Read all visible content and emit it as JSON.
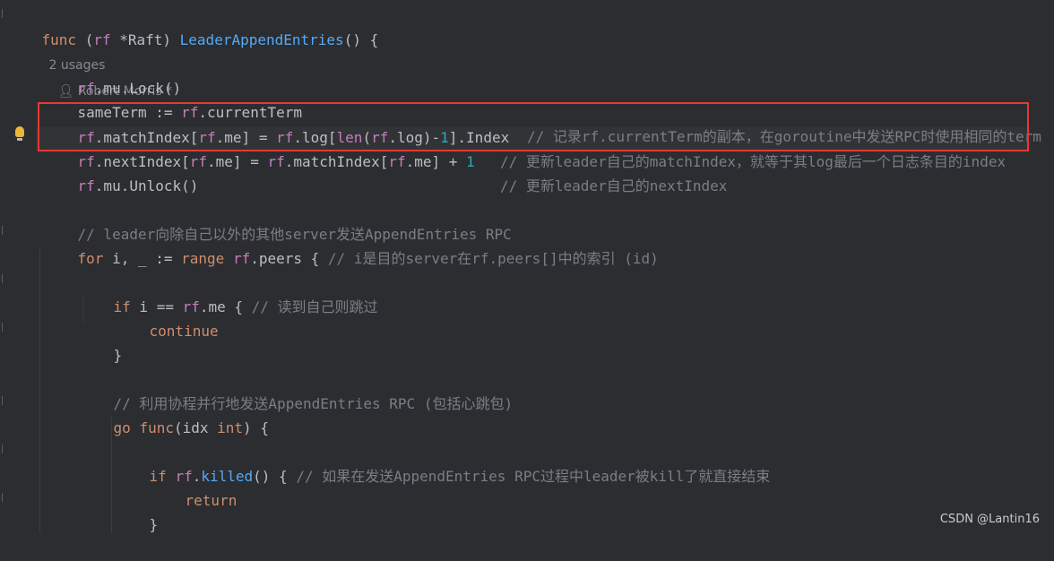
{
  "code": {
    "l1": {
      "kw_func": "func",
      "recv_open": " (",
      "recv": "rf",
      "recv_type": " *Raft) ",
      "fname": "LeaderAppendEntries",
      "rest": "() {",
      "usages": "2 usages",
      "author": "Robert Morris *"
    },
    "l3": {
      "recv": "rf",
      "text": ".mu.Lock()"
    },
    "l4": {
      "a": "sameTerm := ",
      "recv": "rf",
      "b": ".currentTerm",
      "comment": "// 记录rf.currentTerm的副本，在goroutine中发送RPC时使用相同的term"
    },
    "l5": {
      "recv1": "rf",
      "a": ".matchIndex[",
      "recv2": "rf",
      "b": ".me] = ",
      "recv3": "rf",
      "c": ".log[",
      "builtin": "len",
      "d": "(",
      "recv4": "rf",
      "e": ".log)-",
      "num": "1",
      "f": "].Index",
      "comment": "// 更新leader自己的matchIndex，就等于其log最后一个日志条目的index"
    },
    "l6": {
      "recv1": "rf",
      "a": ".nextIndex[",
      "recv2": "rf",
      "b": ".me] = ",
      "recv3": "rf",
      "c": ".matchIndex[",
      "recv4": "rf",
      "d": ".me] + ",
      "num": "1",
      "comment": "// 更新leader自己的nextIndex"
    },
    "l7": {
      "recv": "rf",
      "text": ".mu.Unlock()"
    },
    "l9": {
      "comment": "// leader向除自己以外的其他server发送AppendEntries RPC"
    },
    "l10": {
      "kw_for": "for",
      "a": " i, _ := ",
      "kw_range": "range",
      "b": " ",
      "recv": "rf",
      "c": ".peers { ",
      "comment": "// i是目的server在rf.peers[]中的索引 (id)"
    },
    "l12": {
      "kw_if": "if",
      "a": " i == ",
      "recv": "rf",
      "b": ".me { ",
      "comment": "// 读到自己则跳过"
    },
    "l13": {
      "kw": "continue"
    },
    "l14": {
      "text": "}"
    },
    "l16": {
      "comment": "// 利用协程并行地发送AppendEntries RPC (包括心跳包)"
    },
    "l17": {
      "kw_go": "go",
      "b": " ",
      "kw_func": "func",
      "c": "(idx ",
      "kw_int": "int",
      "d": ") {"
    },
    "l19": {
      "kw_if": "if",
      "a": " ",
      "recv": "rf",
      "b": ".",
      "fn": "killed",
      "c": "() { ",
      "comment": "// 如果在发送AppendEntries RPC过程中leader被kill了就直接结束"
    },
    "l20": {
      "kw": "return"
    },
    "l21": {
      "text": "}"
    }
  },
  "watermark": "CSDN @Lantin16"
}
